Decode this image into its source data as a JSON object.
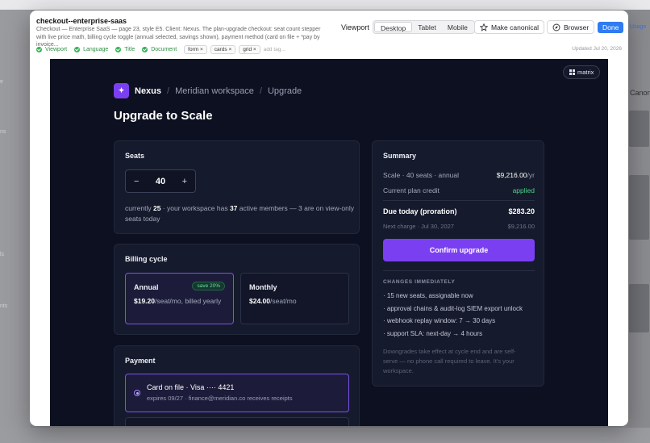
{
  "modal": {
    "title": "checkout--enterprise-saas",
    "description": "Checkout — Enterprise SaaS — page 23, style E5. Client: Nexus. The plan-upgrade checkout: seat count stepper with live price math, billing cycle toggle (annual selected, savings shown), payment method (card on file + *pay by invoice...",
    "viewport_label": "Viewport",
    "viewports": [
      "Desktop",
      "Tablet",
      "Mobile"
    ],
    "active_viewport": "Desktop",
    "make_canonical": "Make canonical",
    "browser": "Browser",
    "done": "Done",
    "checks": [
      "Viewport",
      "Language",
      "Title",
      "Document"
    ],
    "tags": [
      "form ×",
      "cards ×",
      "grid ×"
    ],
    "add_tag_placeholder": "add tag...",
    "updated": "Updated Jul 20, 2026"
  },
  "background": {
    "side_labels": [
      "e",
      "ns",
      "ls",
      "nts"
    ],
    "usage": "Usage",
    "canoni": "Canoni"
  },
  "preview": {
    "matrix_label": "matrix",
    "brand": {
      "logo_glyph": "✦",
      "name": "Nexus",
      "sep": "/",
      "workspace": "Meridian workspace",
      "page": "Upgrade"
    },
    "heading": "Upgrade to Scale",
    "seats": {
      "title": "Seats",
      "minus": "−",
      "value": "40",
      "plus": "+",
      "note_prefix": "currently ",
      "current": "25",
      "note_mid": " · your workspace has ",
      "active": "37",
      "note_suffix": " active members — 3 are on view-only seats today"
    },
    "billing": {
      "title": "Billing cycle",
      "annual": {
        "name": "Annual",
        "badge": "save 20%",
        "price": "$19.20",
        "unit": "/seat/mo, billed yearly"
      },
      "monthly": {
        "name": "Monthly",
        "price": "$24.00",
        "unit": "/seat/mo"
      }
    },
    "payment": {
      "title": "Payment",
      "card_title": "Card on file · Visa ···· 4421",
      "card_sub": "expires 09/27 · finance@meridian.co receives receipts"
    },
    "summary": {
      "title": "Summary",
      "line1_label": "Scale · 40 seats · annual",
      "line1_value": "$9,216.00",
      "line1_unit": "/yr",
      "credit_label": "Current plan credit",
      "credit_value": "applied",
      "due_label": "Due today (proration)",
      "due_value": "$283.20",
      "next_label": "Next charge · Jul 30, 2027",
      "next_value": "$9,216.00",
      "confirm": "Confirm upgrade",
      "changes_heading": "CHANGES IMMEDIATELY",
      "changes": [
        "· 15 new seats, assignable now",
        "· approval chains & audit-log SIEM export unlock",
        "· webhook replay window: 7 → 30 days",
        "· support SLA: next-day → 4 hours"
      ],
      "fineprint": "Downgrades take effect at cycle end and are self-serve — no phone call required to leave. It's your workspace."
    }
  }
}
